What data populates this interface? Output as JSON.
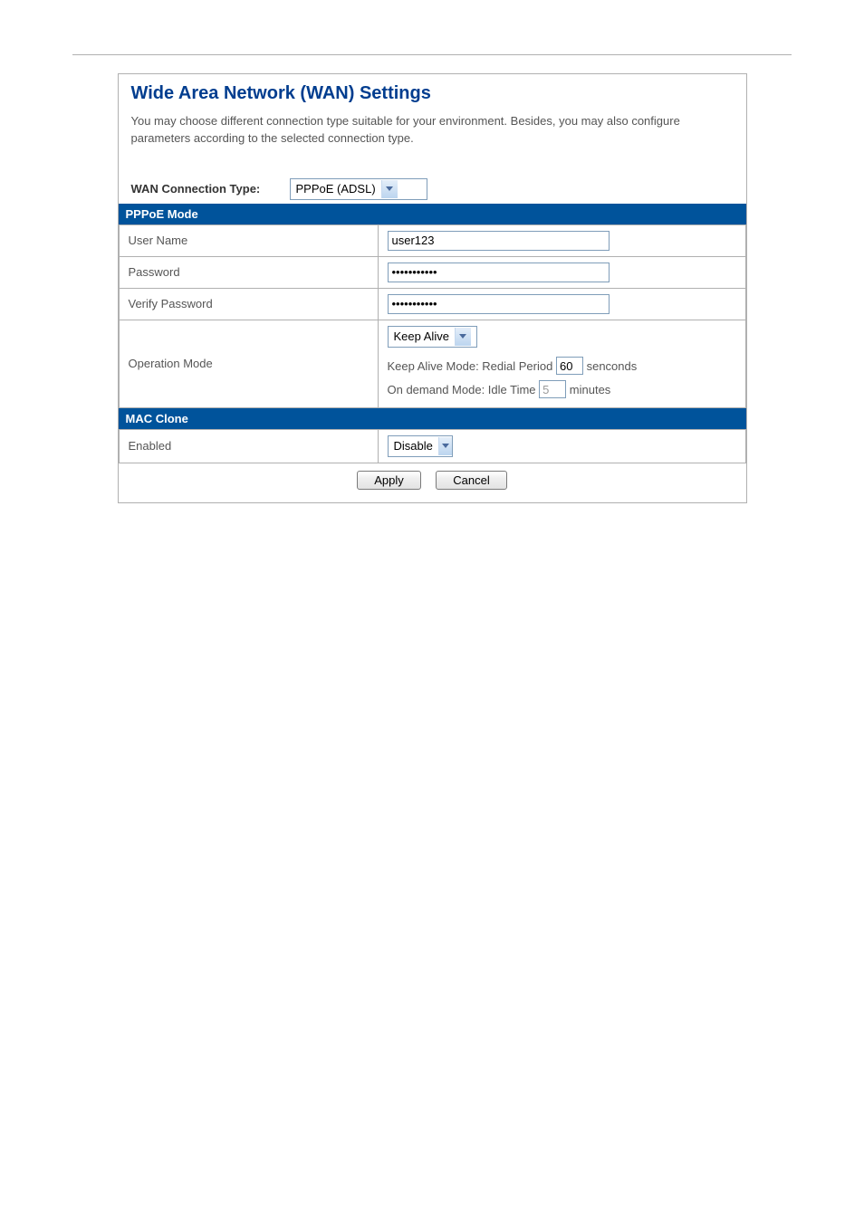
{
  "header": {
    "title": "Wide Area Network (WAN) Settings",
    "description": "You may choose different connection type suitable for your environment. Besides, you may also configure parameters according to the selected connection type."
  },
  "wan": {
    "connection_type_label": "WAN Connection Type:",
    "connection_type_value": "PPPoE (ADSL)"
  },
  "pppoe": {
    "section_title": "PPPoE Mode",
    "username_label": "User Name",
    "username_value": "user123",
    "password_label": "Password",
    "password_value": "•••••••••••",
    "verify_password_label": "Verify Password",
    "verify_password_value": "•••••••••••",
    "operation_mode_label": "Operation Mode",
    "operation_mode_value": "Keep Alive",
    "keepalive_prefix": "Keep Alive Mode: Redial Period",
    "keepalive_value": "60",
    "keepalive_suffix": "senconds",
    "ondemand_prefix": "On demand Mode: Idle Time",
    "ondemand_value": "5",
    "ondemand_suffix": "minutes"
  },
  "macclone": {
    "section_title": "MAC Clone",
    "enabled_label": "Enabled",
    "enabled_value": "Disable"
  },
  "buttons": {
    "apply": "Apply",
    "cancel": "Cancel"
  }
}
